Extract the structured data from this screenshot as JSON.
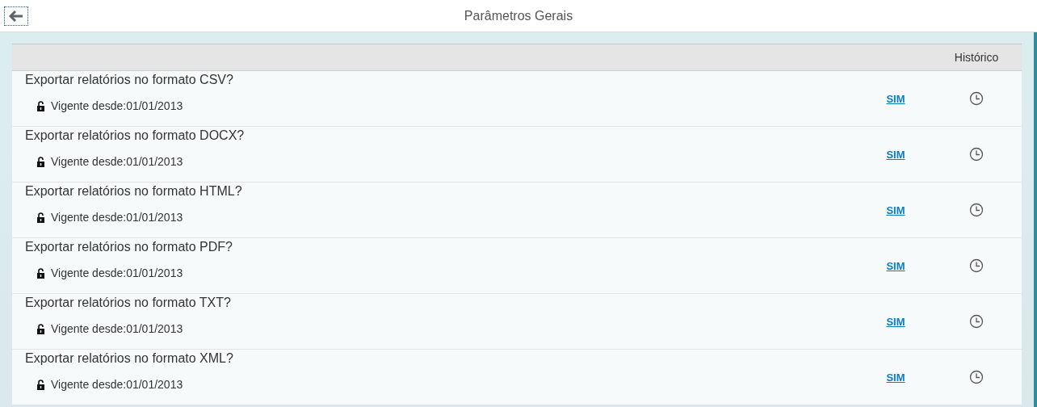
{
  "header": {
    "title": "Parâmetros Gerais"
  },
  "table": {
    "columns": [
      "Histórico"
    ],
    "rows": [
      {
        "question": "Exportar relatórios no formato CSV?",
        "validity": "Vigente desde:01/01/2013",
        "value": "SIM"
      },
      {
        "question": "Exportar relatórios no formato DOCX?",
        "validity": "Vigente desde:01/01/2013",
        "value": "SIM"
      },
      {
        "question": "Exportar relatórios no formato HTML?",
        "validity": "Vigente desde:01/01/2013",
        "value": "SIM"
      },
      {
        "question": "Exportar relatórios no formato PDF?",
        "validity": "Vigente desde:01/01/2013",
        "value": "SIM"
      },
      {
        "question": "Exportar relatórios no formato TXT?",
        "validity": "Vigente desde:01/01/2013",
        "value": "SIM"
      },
      {
        "question": "Exportar relatórios no formato XML?",
        "validity": "Vigente desde:01/01/2013",
        "value": "SIM"
      }
    ]
  }
}
